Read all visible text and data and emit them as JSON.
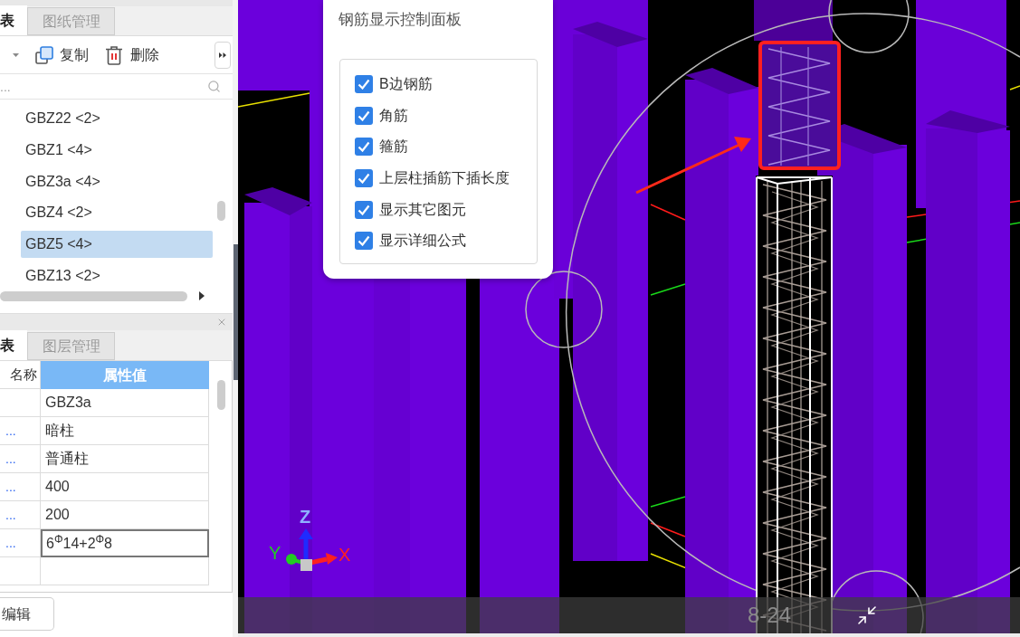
{
  "components_panel": {
    "tabs": [
      {
        "label": "表",
        "selected": true
      },
      {
        "label": "图纸管理",
        "selected": false
      }
    ],
    "toolbar": [
      {
        "kind": "dropdown"
      },
      {
        "kind": "copy",
        "label": "复制"
      },
      {
        "kind": "delete",
        "label": "删除"
      },
      {
        "kind": "more"
      }
    ],
    "search": {
      "placeholder": "..."
    },
    "items": [
      {
        "label": "GBZ22 <2>",
        "selected": false
      },
      {
        "label": "GBZ1 <4>",
        "selected": false
      },
      {
        "label": "GBZ3a <4>",
        "selected": false
      },
      {
        "label": "GBZ4 <2>",
        "selected": false
      },
      {
        "label": "GBZ5 <4>",
        "selected": true
      },
      {
        "label": "GBZ13 <2>",
        "selected": false
      }
    ]
  },
  "properties_panel": {
    "tabs": [
      {
        "label": "表",
        "selected": true
      },
      {
        "label": "图层管理",
        "selected": false
      }
    ],
    "columns": [
      "名称",
      "属性值"
    ],
    "rows": [
      {
        "value": "GBZ3a",
        "selected": false
      },
      {
        "name": "...",
        "value": "暗柱",
        "selected": false
      },
      {
        "name": "...",
        "value": "普通柱",
        "selected": false
      },
      {
        "name": "...",
        "value": "400",
        "selected": false
      },
      {
        "name": "...",
        "value": "200",
        "selected": false
      },
      {
        "name": "...",
        "value": "6$^{Φ}$14+2$^{Φ}$8",
        "selected": true
      },
      {
        "selected": false
      }
    ],
    "edit_button": "编辑"
  },
  "control_panel": {
    "title": "钢筋显示控制面板",
    "options": [
      {
        "label": "B边钢筋",
        "checked": true
      },
      {
        "label": "角筋",
        "checked": true
      },
      {
        "label": "箍筋",
        "checked": true
      },
      {
        "label": "上层柱插筋下插长度",
        "checked": true
      },
      {
        "label": "显示其它图元",
        "checked": true
      },
      {
        "label": "显示详细公式",
        "checked": true
      }
    ]
  },
  "viewport": {
    "axes": {
      "z": "Z",
      "y": "Y",
      "x": "X"
    },
    "grid_label": "8-24"
  }
}
